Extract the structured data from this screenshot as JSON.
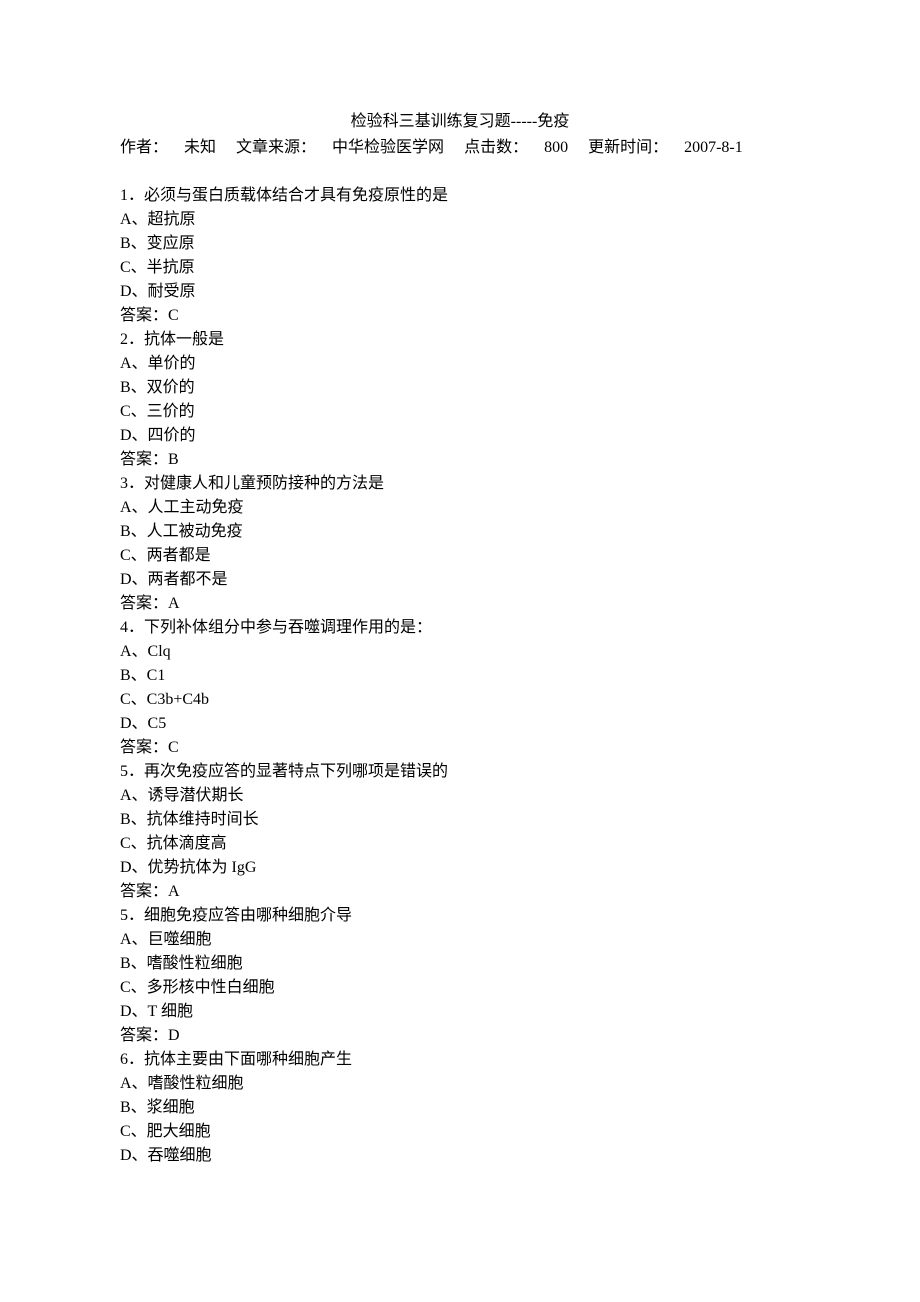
{
  "title": "检验科三基训练复习题-----免疫",
  "meta": {
    "author_label": "作者：",
    "author_value": "未知",
    "source_label": "文章来源：",
    "source_value": "中华检验医学网",
    "hits_label": "点击数：",
    "hits_value": "800",
    "update_label": "更新时间：",
    "update_value": "2007-8-1"
  },
  "answer_prefix": "答案：",
  "questions": [
    {
      "num": "1．",
      "stem": "必须与蛋白质载体结合才具有免疫原性的是",
      "options": [
        "A、超抗原",
        "B、变应原",
        "C、半抗原",
        "D、耐受原"
      ],
      "answer": "C"
    },
    {
      "num": "2．",
      "stem": "抗体一般是",
      "options": [
        "A、单价的",
        "B、双价的",
        "C、三价的",
        "D、四价的"
      ],
      "answer": "B"
    },
    {
      "num": "3．",
      "stem": "对健康人和儿童预防接种的方法是",
      "options": [
        "A、人工主动免疫",
        "B、人工被动免疫",
        "C、两者都是",
        "D、两者都不是"
      ],
      "answer": "A"
    },
    {
      "num": "4．",
      "stem": "下列补体组分中参与吞噬调理作用的是：",
      "options": [
        "A、Clq",
        "B、C1",
        "C、C3b+C4b",
        "D、C5"
      ],
      "answer": "C"
    },
    {
      "num": "5．",
      "stem": "再次免疫应答的显著特点下列哪项是错误的",
      "options": [
        "A、诱导潜伏期长",
        "B、抗体维持时间长",
        "C、抗体滴度高",
        "D、优势抗体为 IgG"
      ],
      "answer": "A"
    },
    {
      "num": "5．",
      "stem": "细胞免疫应答由哪种细胞介导",
      "options": [
        "A、巨噬细胞",
        "B、嗜酸性粒细胞",
        "C、多形核中性白细胞",
        "D、T 细胞"
      ],
      "answer": "D"
    },
    {
      "num": "6．",
      "stem": "抗体主要由下面哪种细胞产生",
      "options": [
        "A、嗜酸性粒细胞",
        "B、浆细胞",
        "C、肥大细胞",
        "D、吞噬细胞"
      ],
      "answer": null
    }
  ]
}
